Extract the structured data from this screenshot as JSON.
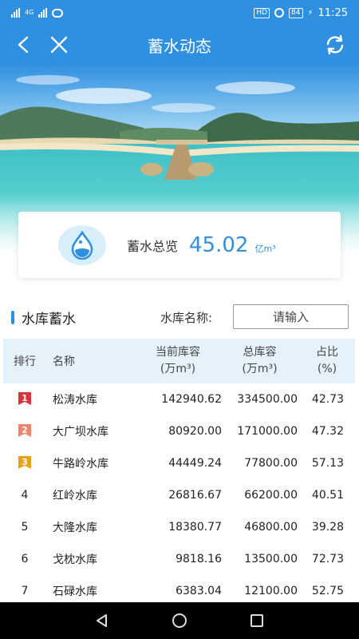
{
  "status_bar": {
    "network_label": "4G",
    "hd_label": "HD",
    "battery": "84",
    "time": "11:25"
  },
  "nav": {
    "title": "蓄水动态",
    "back_icon": "chevron-left-icon",
    "close_icon": "close-icon",
    "refresh_icon": "refresh-icon"
  },
  "summary": {
    "label": "蓄水总览",
    "value": "45.02",
    "unit": "亿m³",
    "icon": "water-drop-icon"
  },
  "section": {
    "title": "水库蓄水",
    "search_label": "水库名称:",
    "search_placeholder": "请输入"
  },
  "table": {
    "headers": {
      "rank": "排行",
      "name": "名称",
      "current_a": "当前库容",
      "current_b": "(万m³)",
      "total_a": "总库容",
      "total_b": "(万m³)",
      "pct_a": "占比",
      "pct_b": "(%)"
    },
    "rows": [
      {
        "rank": "1",
        "name": "松涛水库",
        "current": "142940.62",
        "total": "334500.00",
        "pct": "42.73"
      },
      {
        "rank": "2",
        "name": "大广坝水库",
        "current": "80920.00",
        "total": "171000.00",
        "pct": "47.32"
      },
      {
        "rank": "3",
        "name": "牛路岭水库",
        "current": "44449.24",
        "total": "77800.00",
        "pct": "57.13"
      },
      {
        "rank": "4",
        "name": "红岭水库",
        "current": "26816.67",
        "total": "66200.00",
        "pct": "40.51"
      },
      {
        "rank": "5",
        "name": "大隆水库",
        "current": "18380.77",
        "total": "46800.00",
        "pct": "39.28"
      },
      {
        "rank": "6",
        "name": "戈枕水库",
        "current": "9818.16",
        "total": "13500.00",
        "pct": "72.73"
      },
      {
        "rank": "7",
        "name": "石碌水库",
        "current": "6383.04",
        "total": "12100.00",
        "pct": "52.75"
      }
    ]
  },
  "colors": {
    "primary": "#2f8fe0",
    "gold": "#e0a800",
    "silver": "#f0836a",
    "bronze": "#e8a21a",
    "red": "#d9333a"
  }
}
